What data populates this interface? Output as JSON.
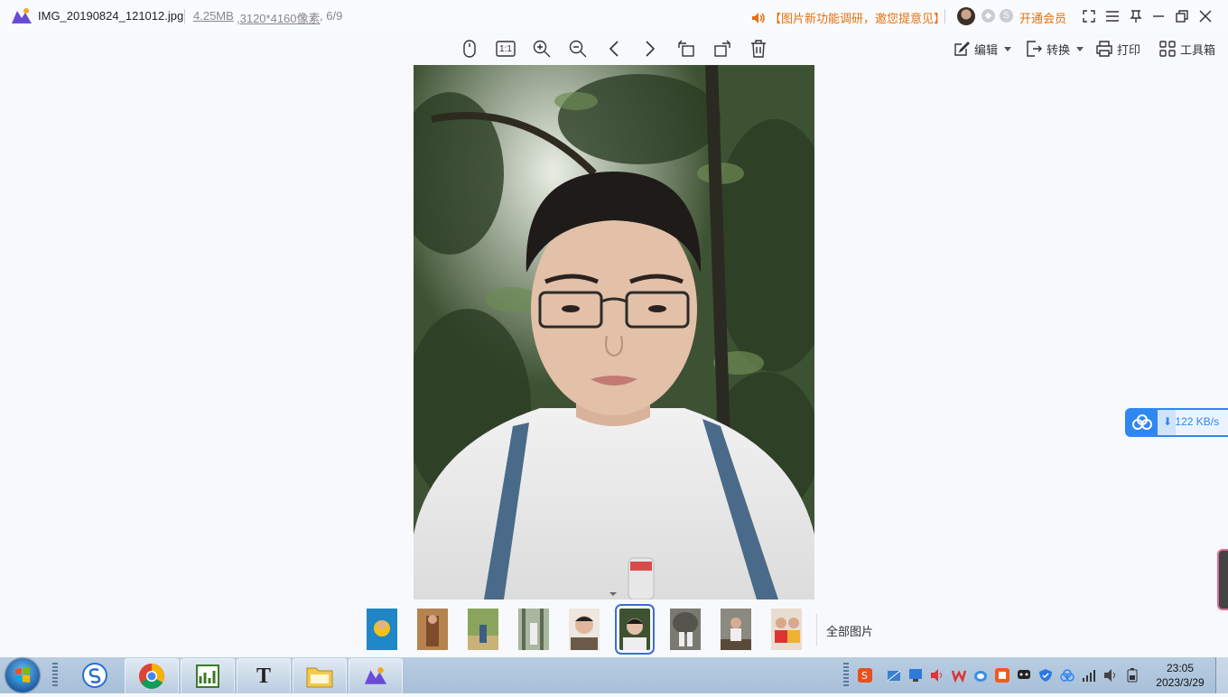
{
  "titlebar": {
    "filename": "IMG_20190824_121012.jpg",
    "filesize": "4.25MB",
    "dimensions": ",3120*4160像素",
    "index": ", 6/9",
    "notice": "【图片新功能调研，邀您提意见】",
    "vip_label": "开通会员"
  },
  "toolbar": {
    "actual_size_label": "1:1",
    "edit_label": "编辑",
    "convert_label": "转换",
    "print_label": "打印",
    "toolbox_label": "工具箱"
  },
  "filmstrip": {
    "current_index": 6,
    "total": 9,
    "all_pictures_label": "全部图片"
  },
  "download_widget": {
    "speed": "122 KB/s"
  },
  "taskbar": {
    "time": "23:05",
    "date": "2023/3/29",
    "notepad_label": "T"
  },
  "colors": {
    "accent_orange": "#e8700e",
    "accent_blue": "#2f87f0",
    "selected_thumb": "#3b6fd8"
  }
}
